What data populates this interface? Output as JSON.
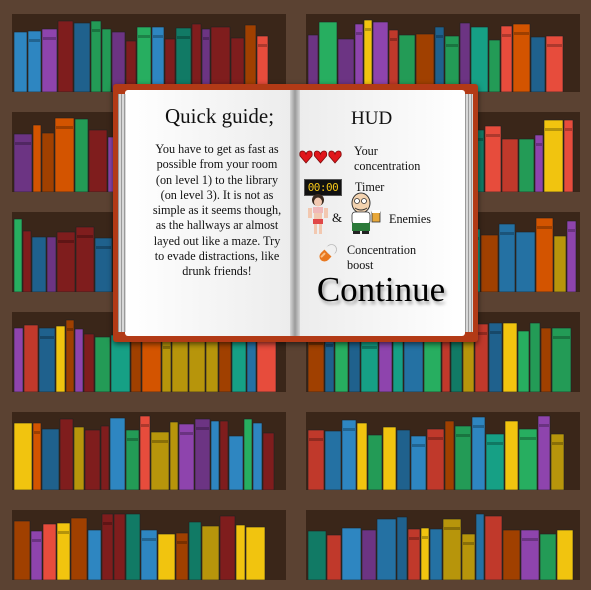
{
  "guide": {
    "title": "Quick guide;",
    "body": "You have to get as fast as possible from your room (on level 1) to the library (on level 3). It is not as simple as it seems though, as the hallways ar almost layed out like a maze. Try to evade distractions, like drunk friends!"
  },
  "hud": {
    "title": "HUD",
    "concentration_label": "Your concentration",
    "timer_label": "Timer",
    "timer_value": "00:00",
    "enemies_and": "&",
    "enemies_label": "Enemies",
    "boost_label": "Concentration boost",
    "hearts": 3,
    "icons": [
      "heart-icon",
      "timer-icon",
      "woman-enemy-icon",
      "man-enemy-icon",
      "pill-icon"
    ]
  },
  "continue_label": "Continue",
  "colors": {
    "wood": "#4a3426",
    "shelf": "#5b4232",
    "book_cover": "#b23a16",
    "heart": "#e0161b",
    "timer_digits": "#f0c419",
    "pill_orange": "#e87820",
    "pill_white": "#f0f0f0"
  }
}
